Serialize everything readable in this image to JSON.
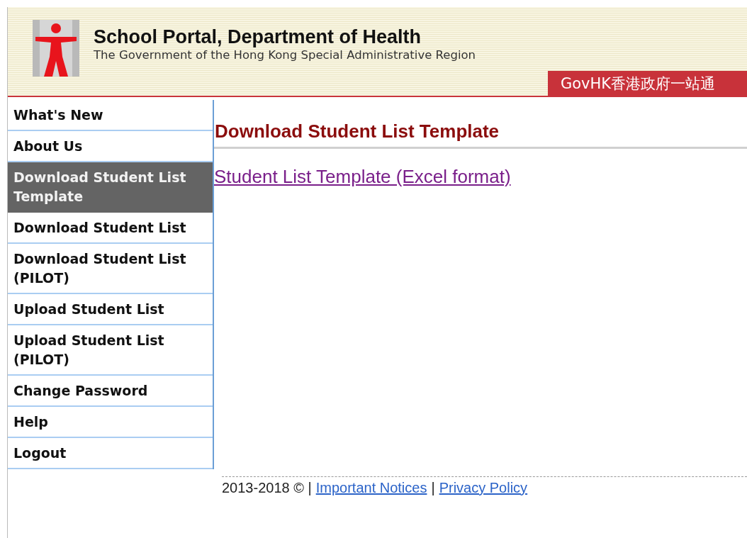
{
  "header": {
    "title": "School Portal, Department of Health",
    "subtitle": "The Government of the Hong Kong Special Administrative Region",
    "govhk": "GovHK香港政府一站通"
  },
  "sidebar": {
    "items": [
      {
        "label": "What's New",
        "selected": false
      },
      {
        "label": "About Us",
        "selected": false
      },
      {
        "label": "Download Student List Template",
        "selected": true
      },
      {
        "label": "Download Student List",
        "selected": false
      },
      {
        "label": "Download Student List (PILOT)",
        "selected": false
      },
      {
        "label": "Upload Student List",
        "selected": false
      },
      {
        "label": "Upload Student List (PILOT)",
        "selected": false
      },
      {
        "label": "Change Password",
        "selected": false
      },
      {
        "label": "Help",
        "selected": false
      },
      {
        "label": "Logout",
        "selected": false
      }
    ]
  },
  "content": {
    "heading": "Download Student List Template",
    "links": [
      "Student List Template (Excel format)"
    ]
  },
  "footer": {
    "parts": [
      {
        "kind": "text",
        "text": "2013-2018 © |"
      },
      {
        "kind": "link",
        "text": "Important Notices"
      },
      {
        "kind": "text",
        "text": "|"
      },
      {
        "kind": "link",
        "text": "Privacy Policy"
      }
    ]
  }
}
